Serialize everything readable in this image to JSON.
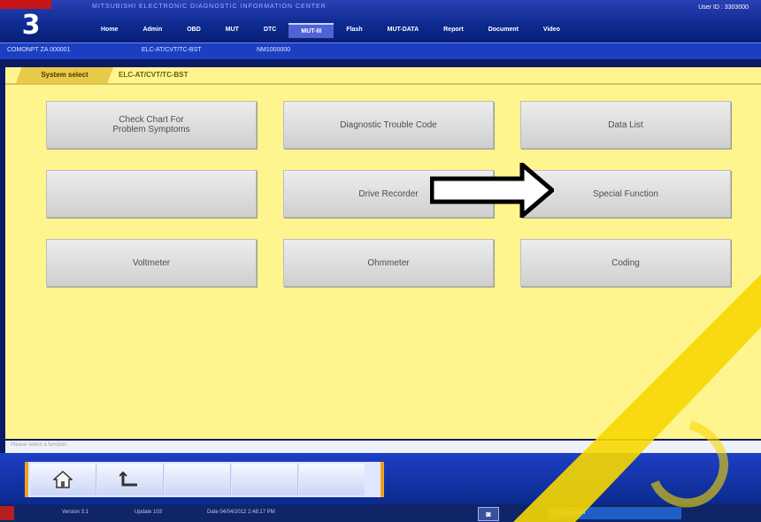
{
  "header": {
    "app_title": "MITSUBISHI ELECTRONIC DIAGNOSTIC INFORMATION CENTER",
    "user_id": "User ID : 3303000",
    "logo_text": "3",
    "nav": [
      "Home",
      "Admin",
      "OBD",
      "MUT",
      "DTC",
      "MUT-III",
      "Flash",
      "MUT-DATA",
      "Report",
      "Document",
      "Video"
    ],
    "active_nav_index": 5
  },
  "breadcrumb": {
    "items": [
      "COMONPT ZA 000001",
      "ELC-AT/CVT/TC-BST",
      "NM1000000"
    ]
  },
  "tabs": {
    "system_select": "System select",
    "ecu": "ELC-AT/CVT/TC-BST"
  },
  "function_buttons": [
    {
      "label": "Check Chart For\nProblem Symptoms",
      "enabled": true
    },
    {
      "label": "Diagnostic Trouble Code",
      "enabled": true
    },
    {
      "label": "Data List",
      "enabled": true
    },
    {
      "label": "",
      "enabled": false
    },
    {
      "label": "Drive Recorder",
      "enabled": true
    },
    {
      "label": "Special Function",
      "enabled": true
    },
    {
      "label": "Voltmeter",
      "enabled": true
    },
    {
      "label": "Ohmmeter",
      "enabled": true
    },
    {
      "label": "Coding",
      "enabled": true
    }
  ],
  "status_line": "Please select a function.",
  "toolbar": {
    "home_icon": "home-icon",
    "back_icon": "back-icon"
  },
  "taskbar": {
    "version": "Version 3.1",
    "update": "Update 103",
    "date": "Date 04/04/2012 2:48:17 PM",
    "tray": "S  Supported"
  },
  "colors": {
    "workspace": "#fff58e",
    "header": "#0d2a8f",
    "accent_orange": "#f0a020",
    "watermark": "#f7d800"
  }
}
